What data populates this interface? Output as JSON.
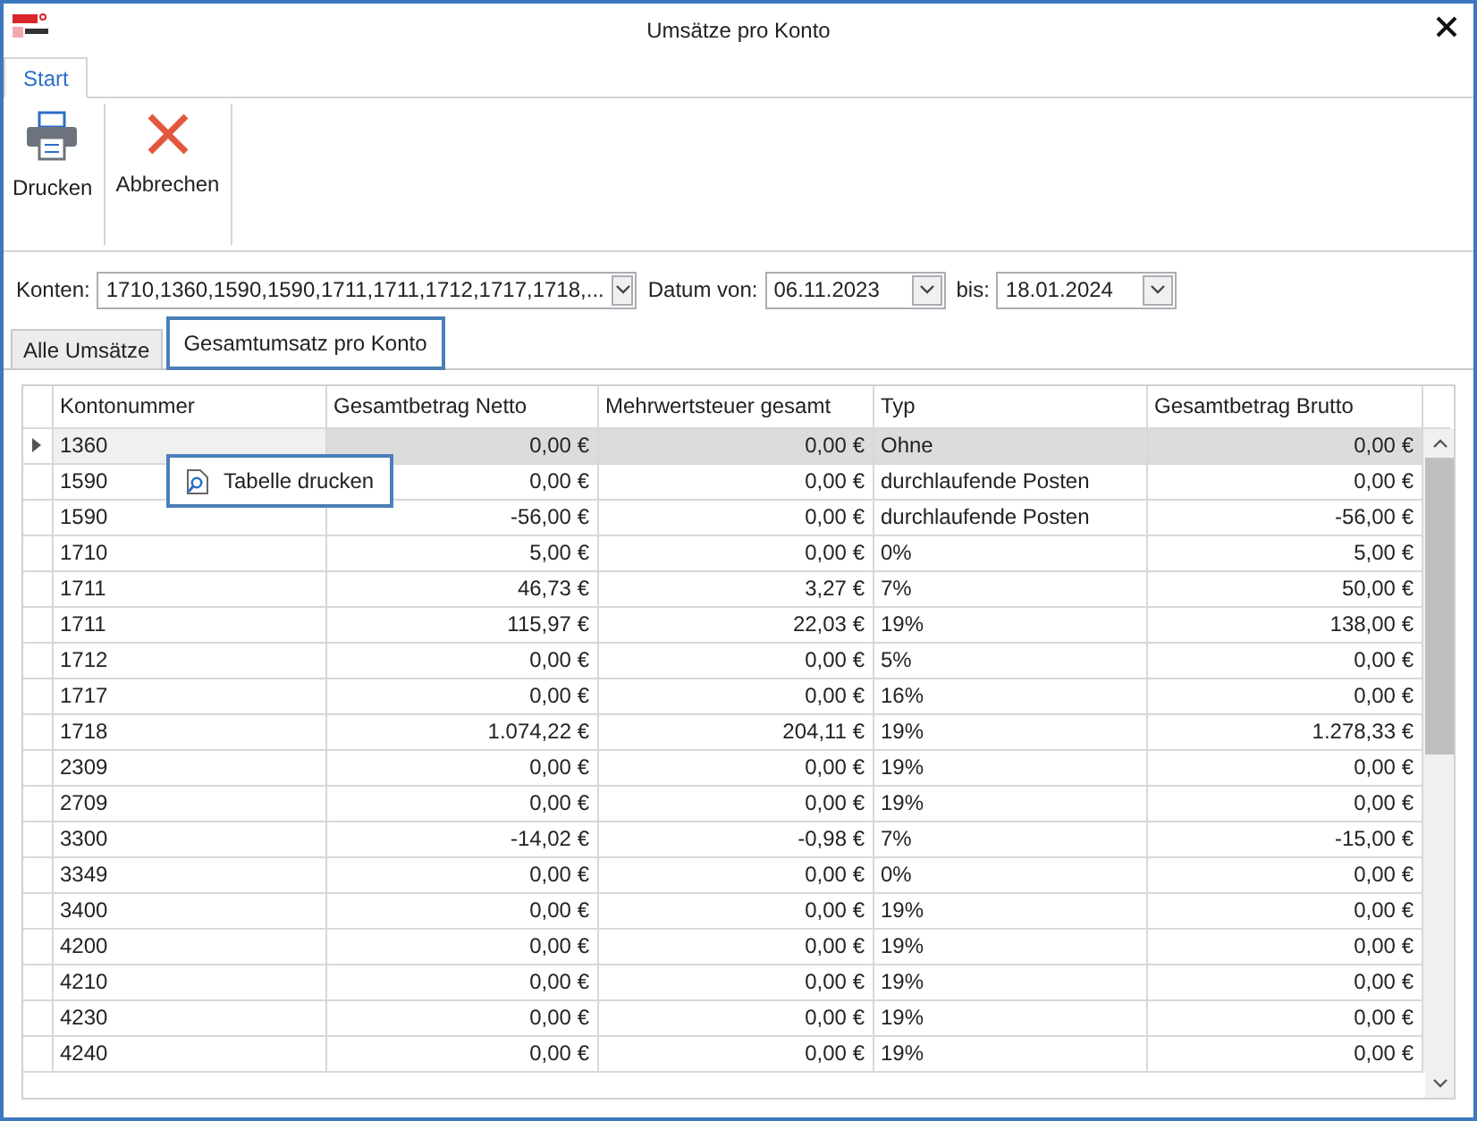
{
  "window": {
    "title": "Umsätze pro Konto"
  },
  "ribbon_tabs": [
    {
      "label": "Start",
      "selected": true
    }
  ],
  "ribbon_buttons": [
    {
      "label": "Drucken",
      "kind": "print"
    },
    {
      "label": "Abbrechen",
      "kind": "cancel"
    }
  ],
  "filters": {
    "konten_label": "Konten:",
    "konten_value": "1710,1360,1590,1590,1711,1711,1712,1717,1718,...",
    "datum_von_label": "Datum von:",
    "datum_von_value": "06.11.2023",
    "bis_label": "bis:",
    "bis_value": "18.01.2024"
  },
  "tabs": [
    {
      "label": "Alle Umsätze",
      "selected": false
    },
    {
      "label": "Gesamtumsatz pro Konto",
      "selected": true
    }
  ],
  "table": {
    "columns": [
      "Kontonummer",
      "Gesamtbetrag Netto",
      "Mehrwertsteuer gesamt",
      "Typ",
      "Gesamtbetrag Brutto"
    ],
    "rows": [
      {
        "cells": [
          "1360",
          "0,00 €",
          "0,00 €",
          "Ohne",
          "0,00 €"
        ],
        "selected": true
      },
      {
        "cells": [
          "1590",
          "0,00 €",
          "0,00 €",
          "durchlaufende Posten",
          "0,00 €"
        ],
        "selected": false
      },
      {
        "cells": [
          "1590",
          "-56,00 €",
          "0,00 €",
          "durchlaufende Posten",
          "-56,00 €"
        ],
        "selected": false
      },
      {
        "cells": [
          "1710",
          "5,00 €",
          "0,00 €",
          "0%",
          "5,00 €"
        ],
        "selected": false
      },
      {
        "cells": [
          "1711",
          "46,73 €",
          "3,27 €",
          "7%",
          "50,00 €"
        ],
        "selected": false
      },
      {
        "cells": [
          "1711",
          "115,97 €",
          "22,03 €",
          "19%",
          "138,00 €"
        ],
        "selected": false
      },
      {
        "cells": [
          "1712",
          "0,00 €",
          "0,00 €",
          "5%",
          "0,00 €"
        ],
        "selected": false
      },
      {
        "cells": [
          "1717",
          "0,00 €",
          "0,00 €",
          "16%",
          "0,00 €"
        ],
        "selected": false
      },
      {
        "cells": [
          "1718",
          "1.074,22 €",
          "204,11 €",
          "19%",
          "1.278,33 €"
        ],
        "selected": false
      },
      {
        "cells": [
          "2309",
          "0,00 €",
          "0,00 €",
          "19%",
          "0,00 €"
        ],
        "selected": false
      },
      {
        "cells": [
          "2709",
          "0,00 €",
          "0,00 €",
          "19%",
          "0,00 €"
        ],
        "selected": false
      },
      {
        "cells": [
          "3300",
          "-14,02 €",
          "-0,98 €",
          "7%",
          "-15,00 €"
        ],
        "selected": false
      },
      {
        "cells": [
          "3349",
          "0,00 €",
          "0,00 €",
          "0%",
          "0,00 €"
        ],
        "selected": false
      },
      {
        "cells": [
          "3400",
          "0,00 €",
          "0,00 €",
          "19%",
          "0,00 €"
        ],
        "selected": false
      },
      {
        "cells": [
          "4200",
          "0,00 €",
          "0,00 €",
          "19%",
          "0,00 €"
        ],
        "selected": false
      },
      {
        "cells": [
          "4210",
          "0,00 €",
          "0,00 €",
          "19%",
          "0,00 €"
        ],
        "selected": false
      },
      {
        "cells": [
          "4230",
          "0,00 €",
          "0,00 €",
          "19%",
          "0,00 €"
        ],
        "selected": false
      },
      {
        "cells": [
          "4240",
          "0,00 €",
          "0,00 €",
          "19%",
          "0,00 €"
        ],
        "selected": false
      }
    ]
  },
  "context_menu": {
    "items": [
      {
        "label": "Tabelle drucken"
      }
    ]
  }
}
